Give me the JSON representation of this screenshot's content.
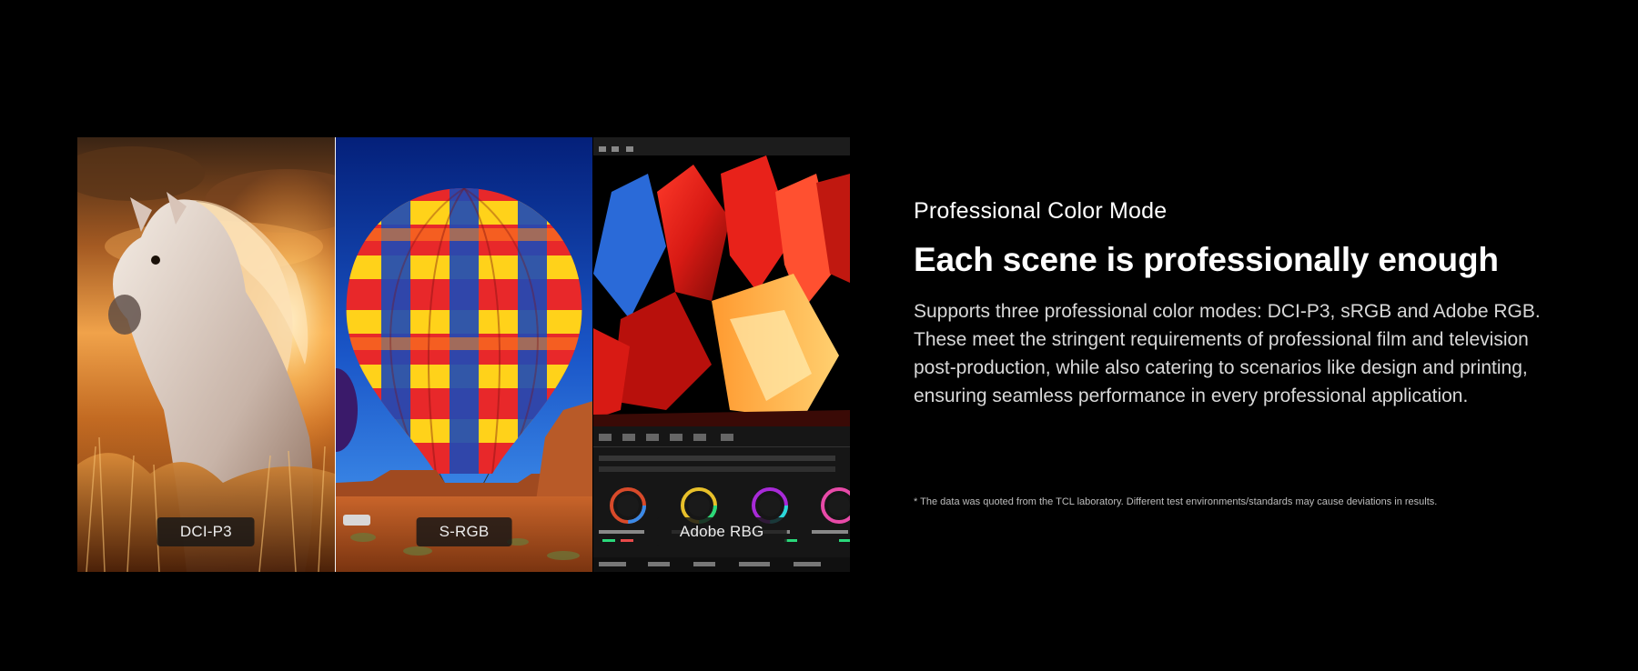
{
  "gallery": {
    "panels": [
      {
        "label": "DCI-P3"
      },
      {
        "label": "S-RGB"
      },
      {
        "label": "Adobe RBG"
      }
    ]
  },
  "content": {
    "eyebrow": "Professional Color Mode",
    "headline": "Each scene is professionally enough",
    "body": "Supports three professional color modes: DCI-P3, sRGB and Adobe RGB. These meet the stringent requirements of professional film and television post-production, while also catering to scenarios like design and printing, ensuring seamless performance in every professional application.",
    "footnote": "* The data was quoted from the TCL laboratory. Different test environments/standards may cause deviations in results."
  },
  "colors": {
    "background": "#000000",
    "text": "#ffffff",
    "body_text": "#d8d8d8"
  }
}
